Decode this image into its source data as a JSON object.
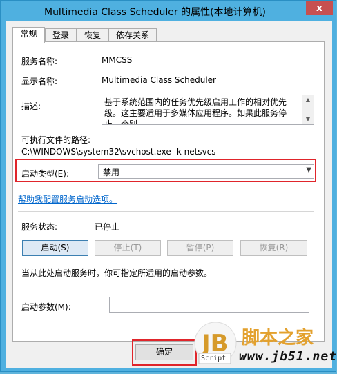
{
  "window": {
    "title": "Multimedia Class Scheduler 的属性(本地计算机)",
    "close_glyph": "x"
  },
  "tabs": [
    "常规",
    "登录",
    "恢复",
    "依存关系"
  ],
  "general": {
    "service_name_label": "服务名称:",
    "service_name_value": "MMCSS",
    "display_name_label": "显示名称:",
    "display_name_value": "Multimedia Class Scheduler",
    "description_label": "描述:",
    "description_value": "基于系统范围内的任务优先级启用工作的相对优先级。这主要适用于多媒体应用程序。如果此服务停止，个别",
    "exe_path_label": "可执行文件的路径:",
    "exe_path_value": "C:\\WINDOWS\\system32\\svchost.exe -k netsvcs",
    "startup_type_label": "启动类型(E):",
    "startup_type_value": "禁用",
    "help_link": "帮助我配置服务启动选项。",
    "service_status_label": "服务状态:",
    "service_status_value": "已停止",
    "start_button": "启动(S)",
    "stop_button": "停止(T)",
    "pause_button": "暂停(P)",
    "resume_button": "恢复(R)",
    "hint_text": "当从此处启动服务时，你可指定所适用的启动参数。",
    "start_params_label": "启动参数(M):",
    "start_params_value": ""
  },
  "footer": {
    "ok_button": "确定"
  },
  "watermark": {
    "site_name": "脚本之家",
    "url": "www.jb51.net",
    "logo_letters": "JB",
    "logo_sub": "Script"
  },
  "colors": {
    "highlight_red": "#e0252b",
    "link_blue": "#0066cc",
    "title_bar": "#4fb0e0",
    "close_red": "#c75050"
  }
}
